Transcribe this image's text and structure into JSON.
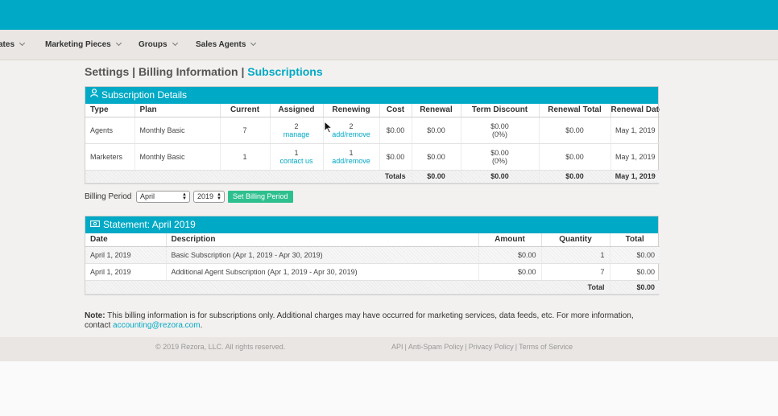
{
  "nav": {
    "items": [
      {
        "label": "ates"
      },
      {
        "label": "Marketing Pieces"
      },
      {
        "label": "Groups"
      },
      {
        "label": "Sales Agents"
      }
    ]
  },
  "page_title": {
    "part1": "Settings",
    "sep": "|",
    "part2": "Billing Information",
    "part3": "Subscriptions"
  },
  "subscription": {
    "heading": "Subscription Details",
    "columns": [
      "Type",
      "Plan",
      "Current",
      "Assigned",
      "Renewing",
      "Cost",
      "Renewal",
      "Term Discount",
      "Renewal Total",
      "Renewal Date"
    ],
    "rows": [
      {
        "type": "Agents",
        "plan": "Monthly Basic",
        "current": "7",
        "assigned": "2",
        "assigned_link": "manage",
        "renewing": "2",
        "renewing_link": "add/remove",
        "cost": "$0.00",
        "renewal": "$0.00",
        "term_discount": "$0.00",
        "term_discount_pct": "(0%)",
        "renewal_total": "$0.00",
        "renewal_date": "May 1, 2019"
      },
      {
        "type": "Marketers",
        "plan": "Monthly Basic",
        "current": "1",
        "assigned": "1",
        "assigned_link": "contact us",
        "renewing": "1",
        "renewing_link": "add/remove",
        "cost": "$0.00",
        "renewal": "$0.00",
        "term_discount": "$0.00",
        "term_discount_pct": "(0%)",
        "renewal_total": "$0.00",
        "renewal_date": "May 1, 2019"
      }
    ],
    "totals": {
      "label": "Totals",
      "renewal": "$0.00",
      "term_discount": "$0.00",
      "renewal_total": "$0.00",
      "renewal_date": "May 1, 2019"
    }
  },
  "billing_period": {
    "label": "Billing Period",
    "month": "April",
    "year": "2019",
    "button": "Set Billing Period"
  },
  "statement": {
    "heading": "Statement: April 2019",
    "columns": [
      "Date",
      "Description",
      "Amount",
      "Quantity",
      "Total"
    ],
    "rows": [
      {
        "date": "April 1, 2019",
        "description": "Basic Subscription (Apr 1, 2019 - Apr 30, 2019)",
        "amount": "$0.00",
        "quantity": "1",
        "total": "$0.00"
      },
      {
        "date": "April 1, 2019",
        "description": "Additional Agent Subscription (Apr 1, 2019 - Apr 30, 2019)",
        "amount": "$0.00",
        "quantity": "7",
        "total": "$0.00"
      }
    ],
    "total_label": "Total",
    "total_value": "$0.00"
  },
  "note": {
    "bold": "Note:",
    "text": " This billing information is for subscriptions only. Additional charges may have occurred for marketing services, data feeds, etc. For more information, contact ",
    "email": "accounting@rezora.com",
    "end": "."
  },
  "footer": {
    "copyright": "© 2019 Rezora, LLC. All rights reserved.",
    "links": [
      "API",
      "Anti-Spam Policy",
      "Privacy Policy",
      "Terms of Service"
    ]
  },
  "colors": {
    "brand": "#00a9c5",
    "button": "#2ebf8f"
  }
}
